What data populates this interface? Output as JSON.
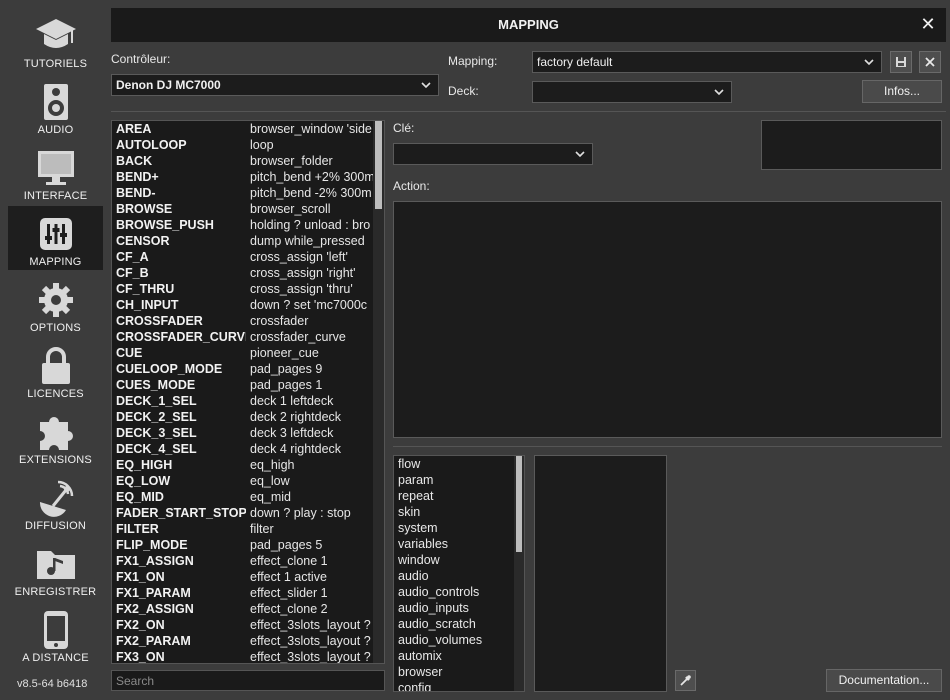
{
  "sidebar": {
    "items": [
      {
        "label": "TUTORIELS",
        "icon": "graduation-cap-icon"
      },
      {
        "label": "AUDIO",
        "icon": "speaker-icon"
      },
      {
        "label": "INTERFACE",
        "icon": "monitor-icon"
      },
      {
        "label": "MAPPING",
        "icon": "sliders-icon"
      },
      {
        "label": "OPTIONS",
        "icon": "gear-icon"
      },
      {
        "label": "LICENCES",
        "icon": "lock-icon"
      },
      {
        "label": "EXTENSIONS",
        "icon": "puzzle-icon"
      },
      {
        "label": "DIFFUSION",
        "icon": "broadcast-icon"
      },
      {
        "label": "ENREGISTRER",
        "icon": "music-folder-icon"
      },
      {
        "label": "A DISTANCE",
        "icon": "phone-icon"
      }
    ],
    "active": "MAPPING",
    "version": "v8.5-64 b6418"
  },
  "window": {
    "title": "MAPPING",
    "close": "✕"
  },
  "controller": {
    "label": "Contrôleur:",
    "value": "Denon DJ MC7000"
  },
  "mapping": {
    "label": "Mapping:",
    "value": "factory default"
  },
  "deck": {
    "label": "Deck:",
    "value": ""
  },
  "infos_button": "Infos...",
  "key": {
    "label": "Clé:",
    "value": ""
  },
  "action": {
    "label": "Action:"
  },
  "documentation_button": "Documentation...",
  "search": {
    "placeholder": "Search"
  },
  "mappings": [
    {
      "key": "AREA",
      "action": "browser_window 'side"
    },
    {
      "key": "AUTOLOOP",
      "action": "loop"
    },
    {
      "key": "BACK",
      "action": "browser_folder"
    },
    {
      "key": "BEND+",
      "action": "pitch_bend +2% 300m"
    },
    {
      "key": "BEND-",
      "action": "pitch_bend -2% 300m"
    },
    {
      "key": "BROWSE",
      "action": "browser_scroll"
    },
    {
      "key": "BROWSE_PUSH",
      "action": "holding ? unload : bro"
    },
    {
      "key": "CENSOR",
      "action": "dump while_pressed"
    },
    {
      "key": "CF_A",
      "action": "cross_assign 'left'"
    },
    {
      "key": "CF_B",
      "action": "cross_assign 'right'"
    },
    {
      "key": "CF_THRU",
      "action": "cross_assign 'thru'"
    },
    {
      "key": "CH_INPUT",
      "action": "down ? set 'mc7000c"
    },
    {
      "key": "CROSSFADER",
      "action": "crossfader"
    },
    {
      "key": "CROSSFADER_CURVE",
      "action": "crossfader_curve"
    },
    {
      "key": "CUE",
      "action": "pioneer_cue"
    },
    {
      "key": "CUELOOP_MODE",
      "action": "pad_pages 9"
    },
    {
      "key": "CUES_MODE",
      "action": "pad_pages 1"
    },
    {
      "key": "DECK_1_SEL",
      "action": "deck 1 leftdeck"
    },
    {
      "key": "DECK_2_SEL",
      "action": "deck 2 rightdeck"
    },
    {
      "key": "DECK_3_SEL",
      "action": "deck 3 leftdeck"
    },
    {
      "key": "DECK_4_SEL",
      "action": "deck 4 rightdeck"
    },
    {
      "key": "EQ_HIGH",
      "action": "eq_high"
    },
    {
      "key": "EQ_LOW",
      "action": "eq_low"
    },
    {
      "key": "EQ_MID",
      "action": "eq_mid"
    },
    {
      "key": "FADER_START_STOP",
      "action": "down ? play : stop"
    },
    {
      "key": "FILTER",
      "action": "filter"
    },
    {
      "key": "FLIP_MODE",
      "action": "pad_pages 5"
    },
    {
      "key": "FX1_ASSIGN",
      "action": "effect_clone 1"
    },
    {
      "key": "FX1_ON",
      "action": "effect 1 active"
    },
    {
      "key": "FX1_PARAM",
      "action": "effect_slider 1"
    },
    {
      "key": "FX2_ASSIGN",
      "action": "effect_clone 2"
    },
    {
      "key": "FX2_ON",
      "action": "effect_3slots_layout ?"
    },
    {
      "key": "FX2_PARAM",
      "action": "effect_3slots_layout ?"
    },
    {
      "key": "FX3_ON",
      "action": "effect_3slots_layout ?"
    }
  ],
  "categories": [
    "flow",
    "param",
    "repeat",
    "skin",
    "system",
    "variables",
    "window",
    "audio",
    "audio_controls",
    "audio_inputs",
    "audio_scratch",
    "audio_volumes",
    "automix",
    "browser",
    "config"
  ],
  "colors": {
    "background": "#3c3c3c",
    "panel": "#1a1a1a",
    "active_nav": "#1e1e1e"
  }
}
